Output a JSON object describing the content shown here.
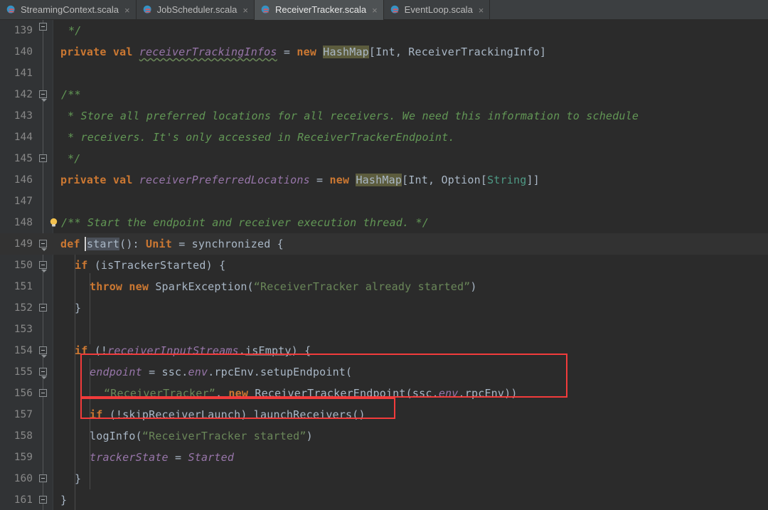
{
  "window": {
    "app": "IntelliJ IDEA",
    "theme_bg": "#2b2b2b",
    "gutter_bg": "#313335",
    "accent_annotation": "#f23b3b"
  },
  "tabbar": {
    "tabs": [
      {
        "label": "StreamingContext.scala",
        "icon": "scala-file-icon",
        "close": "×",
        "active": false
      },
      {
        "label": "JobScheduler.scala",
        "icon": "scala-file-icon",
        "close": "×",
        "active": false
      },
      {
        "label": "ReceiverTracker.scala",
        "icon": "scala-file-icon",
        "close": "×",
        "active": true
      },
      {
        "label": "EventLoop.scala",
        "icon": "scala-file-icon",
        "close": "×",
        "active": false
      }
    ]
  },
  "editor": {
    "language": "scala",
    "current_line": 149,
    "caret_line": 149,
    "caret_column": 7,
    "search_highlight_token": "HashMap",
    "lines": [
      {
        "n": "139"
      },
      {
        "n": "140"
      },
      {
        "n": "141"
      },
      {
        "n": "142"
      },
      {
        "n": "143"
      },
      {
        "n": "144"
      },
      {
        "n": "145"
      },
      {
        "n": "146"
      },
      {
        "n": "147"
      },
      {
        "n": "148"
      },
      {
        "n": "149"
      },
      {
        "n": "150"
      },
      {
        "n": "151"
      },
      {
        "n": "152"
      },
      {
        "n": "153"
      },
      {
        "n": "154"
      },
      {
        "n": "155"
      },
      {
        "n": "156"
      },
      {
        "n": "157"
      },
      {
        "n": "158"
      },
      {
        "n": "159"
      },
      {
        "n": "160"
      },
      {
        "n": "161"
      }
    ],
    "code": {
      "l139": "*/",
      "l140_private": "private",
      "l140_val": "val",
      "l140_name": "receiverTrackingInfos",
      "l140_eq": "=",
      "l140_new": "new",
      "l140_hashmap": "HashMap",
      "l140_generic": "[Int, ReceiverTrackingInfo]",
      "l142": "/**",
      "l143": "* Store all preferred locations for all receivers. We need this information to schedule",
      "l144": "* receivers. It's only accessed in ReceiverTrackerEndpoint.",
      "l145": "*/",
      "l146_private": "private",
      "l146_val": "val",
      "l146_name": "receiverPreferredLocations",
      "l146_eq": "=",
      "l146_new": "new",
      "l146_hashmap": "HashMap",
      "l146_g1": "[Int, Option[",
      "l146_string": "String",
      "l146_g2": "]]",
      "l148": "/** Start the endpoint and receiver execution thread. */",
      "l149_def": "def",
      "l149_name": "start",
      "l149_parens": "(): ",
      "l149_unit": "Unit",
      "l149_rest": " = synchronized {",
      "l150_if": "if",
      "l150_rest": " (isTrackerStarted) {",
      "l151_throw": "throw",
      "l151_new": "new",
      "l151_cls": "SparkException(",
      "l151_str": "“ReceiverTracker already started”",
      "l151_end": ")",
      "l152": "}",
      "l154_if": "if",
      "l154_p1": " (!",
      "l154_field": "receiverInputStreams",
      "l154_dot": ".",
      "l154_stat": "isEmpty",
      "l154_p2": ") {",
      "l155_field": "endpoint",
      "l155_rest": " = ssc.",
      "l155_env": "env",
      "l155_rest2": ".rpcEnv.setupEndpoint(",
      "l156_str": "“ReceiverTracker”",
      "l156_comma": ", ",
      "l156_new": "new",
      "l156_cls": " ReceiverTrackerEndpoint(ssc.",
      "l156_env": "env",
      "l156_end": ".rpcEnv))",
      "l157_if": "if",
      "l157_rest": " (!skipReceiverLaunch) launchReceivers()",
      "l158_call": "logInfo(",
      "l158_str": "“ReceiverTracker started”",
      "l158_end": ")",
      "l159_field": "trackerState",
      "l159_eq": " = ",
      "l159_val": "Started",
      "l160": "}",
      "l161": "}"
    },
    "annotations": [
      {
        "name": "red-box-endpoint-setup",
        "note": "highlights lines 155-156"
      },
      {
        "name": "red-box-launch-receivers",
        "note": "highlights line 157"
      }
    ]
  }
}
